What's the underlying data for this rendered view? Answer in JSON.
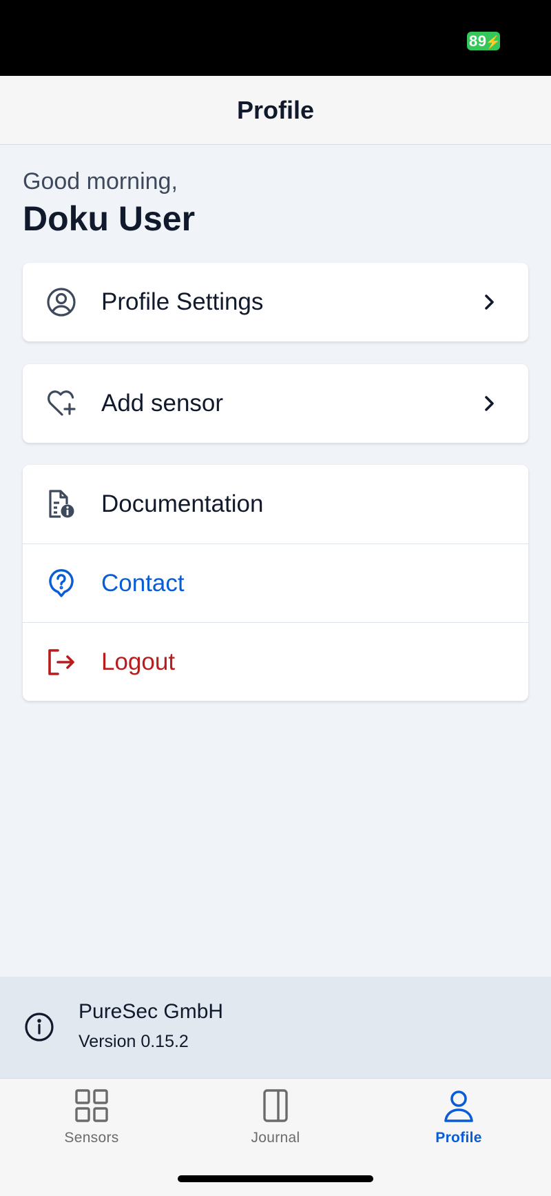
{
  "status_bar": {
    "battery_level": "89"
  },
  "header": {
    "title": "Profile"
  },
  "greeting": {
    "line1": "Good morning,",
    "name": "Doku User"
  },
  "menu_group1": [
    {
      "label": "Profile Settings",
      "icon": "user-circle-icon",
      "color": "#111a2c"
    }
  ],
  "menu_group2": [
    {
      "label": "Add sensor",
      "icon": "heart-plus-icon",
      "color": "#111a2c"
    }
  ],
  "menu_group3": [
    {
      "label": "Documentation",
      "icon": "document-info-icon",
      "color": "#111a2c"
    },
    {
      "label": "Contact",
      "icon": "help-bubble-icon",
      "color": "#0a5bd6"
    },
    {
      "label": "Logout",
      "icon": "logout-icon",
      "color": "#b91c1c"
    }
  ],
  "footer": {
    "company": "PureSec GmbH",
    "version": "Version 0.15.2",
    "icon": "info-icon"
  },
  "tabs": [
    {
      "label": "Sensors",
      "icon": "grid-icon",
      "active": false
    },
    {
      "label": "Journal",
      "icon": "book-icon",
      "active": false
    },
    {
      "label": "Profile",
      "icon": "user-icon",
      "active": true
    }
  ],
  "colors": {
    "accent": "#0a5bd6",
    "danger": "#b91c1c",
    "background": "#f0f3f7",
    "battery": "#34c759"
  }
}
